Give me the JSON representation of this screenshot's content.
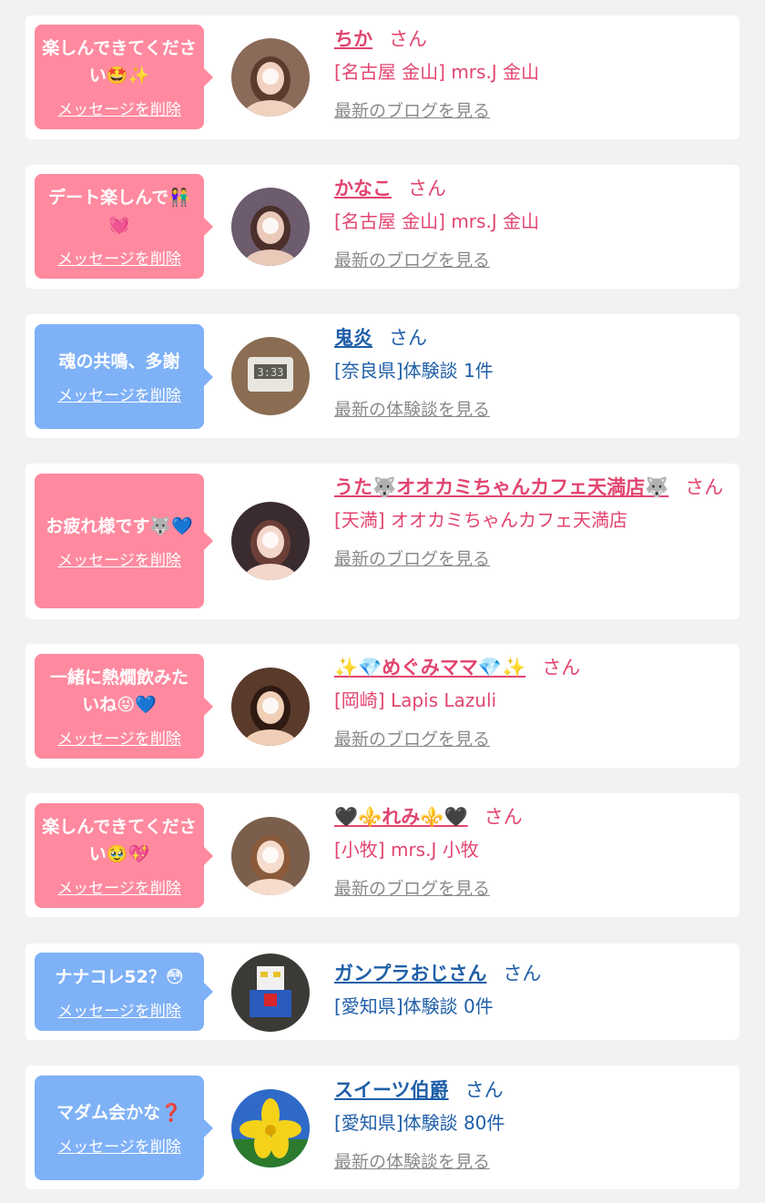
{
  "colors": {
    "page_bg": "#f2f2f2",
    "pink_bubble": "#ff8a9f",
    "blue_bubble": "#7fb1f7",
    "pink_text": "#e2456f",
    "blue_text": "#1f5fa8",
    "gray_link": "#8a8a8a"
  },
  "delete_label": "メッセージを削除",
  "san_suffix": "さん",
  "items": [
    {
      "theme": "pink",
      "message": "楽しんできてください🤩✨",
      "name": "ちか",
      "shop": "[名古屋 金山] mrs.J 金山",
      "link": "最新のブログを見る",
      "avatar_icon": "girl-photo-avatar"
    },
    {
      "theme": "pink",
      "message": "デート楽しんで👫💓",
      "name": "かなこ",
      "shop": "[名古屋 金山] mrs.J 金山",
      "link": "最新のブログを見る",
      "avatar_icon": "girl-photo-avatar"
    },
    {
      "theme": "blue",
      "message": "魂の共鳴、多謝",
      "name": "鬼炎",
      "shop": "[奈良県]体験談 1件",
      "link": "最新の体験談を見る",
      "avatar_icon": "clock-photo-avatar"
    },
    {
      "theme": "pink",
      "message": "お疲れ様です🐺💙",
      "name": "うた🐺オオカミちゃんカフェ天満店🐺",
      "shop": "[天満] オオカミちゃんカフェ天満店",
      "link": "最新のブログを見る",
      "avatar_icon": "girl-photo-avatar"
    },
    {
      "theme": "pink",
      "message": "一緒に熱燗飲みたいね😝💙",
      "name": "✨💎めぐみママ💎✨",
      "shop": "[岡崎] Lapis Lazuli",
      "link": "最新のブログを見る",
      "avatar_icon": "girl-photo-avatar"
    },
    {
      "theme": "pink",
      "message": "楽しんできてください🥹💖",
      "name": "🖤⚜️れみ⚜️🖤",
      "shop": "[小牧] mrs.J 小牧",
      "link": "最新のブログを見る",
      "avatar_icon": "girl-photo-avatar"
    },
    {
      "theme": "blue",
      "message": "ナナコレ52？😳",
      "name": "ガンプラおじさん",
      "shop": "[愛知県]体験談 0件",
      "link": "",
      "avatar_icon": "robot-photo-avatar"
    },
    {
      "theme": "blue",
      "message": "マダム会かな❓",
      "name": "スイーツ伯爵",
      "shop": "[愛知県]体験談 80件",
      "link": "最新の体験談を見る",
      "avatar_icon": "flower-photo-avatar"
    }
  ]
}
